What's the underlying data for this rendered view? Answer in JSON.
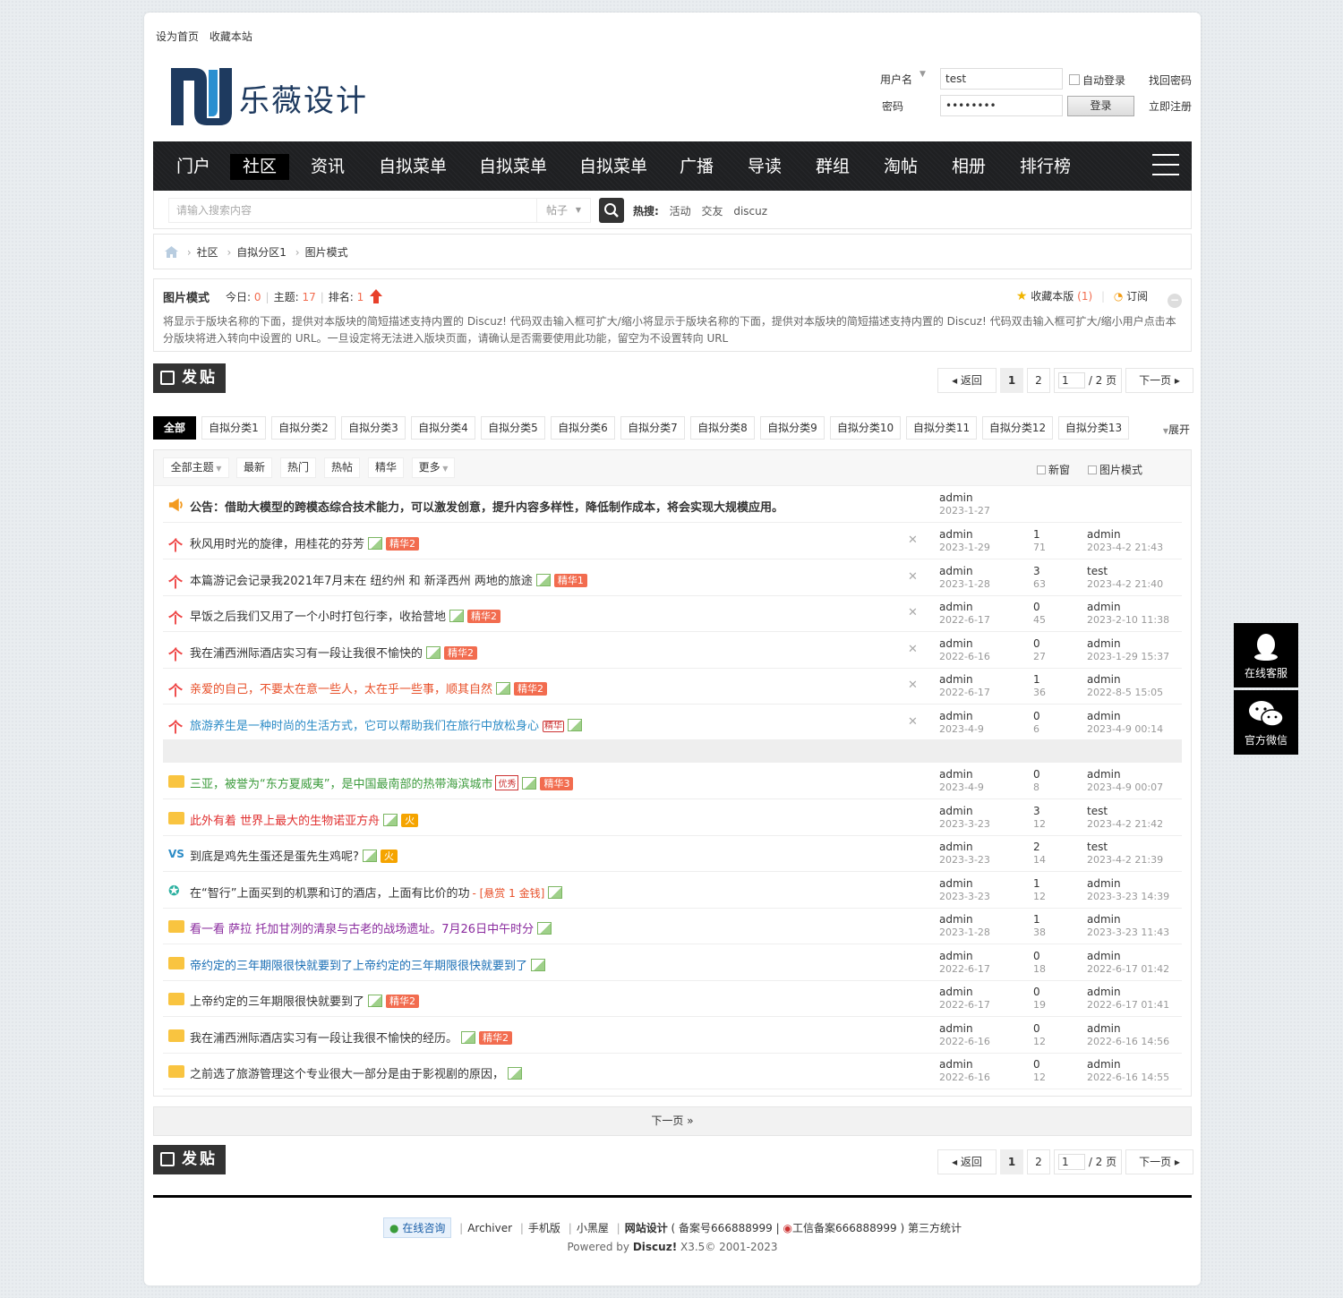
{
  "topnav": {
    "set_home": "设为首页",
    "bookmark": "收藏本站"
  },
  "logo": {
    "text": "乐薇设计"
  },
  "login": {
    "username_label": "用户名",
    "username_value": "test",
    "auto_login": "自动登录",
    "forgot": "找回密码",
    "password_label": "密码",
    "password_value": "••••••••",
    "login_btn": "登录",
    "register": "立即注册"
  },
  "mainnav": [
    "门户",
    "社区",
    "资讯",
    "自拟菜单",
    "自拟菜单",
    "自拟菜单",
    "广播",
    "导读",
    "群组",
    "淘帖",
    "相册",
    "排行榜"
  ],
  "search": {
    "placeholder": "请输入搜索内容",
    "type": "帖子",
    "hot_label": "热搜:",
    "hot": [
      "活动",
      "交友",
      "discuz"
    ]
  },
  "breadcrumb": [
    "社区",
    "自拟分区1",
    "图片模式"
  ],
  "forum": {
    "title": "图片模式",
    "today_label": "今日:",
    "today": "0",
    "topics_label": "主题:",
    "topics": "17",
    "rank_label": "排名:",
    "rank": "1",
    "favorite": "收藏本版",
    "favorite_count": "(1)",
    "subscribe": "订阅",
    "desc": "将显示于版块名称的下面，提供对本版块的简短描述支持内置的 Discuz! 代码双击输入框可扩大/缩小将显示于版块名称的下面，提供对本版块的简短描述支持内置的 Discuz! 代码双击输入框可扩大/缩小用户点击本分版块将进入转向中设置的 URL。一旦设定将无法进入版块页面，请确认是否需要使用此功能，留空为不设置转向 URL"
  },
  "post_btn": "发贴",
  "pager": {
    "back": "返回",
    "p1": "1",
    "p2": "2",
    "input": "1",
    "total": "/ 2 页",
    "next": "下一页"
  },
  "typetabs": [
    "全部",
    "自拟分类1",
    "自拟分类2",
    "自拟分类3",
    "自拟分类4",
    "自拟分类5",
    "自拟分类6",
    "自拟分类7",
    "自拟分类8",
    "自拟分类9",
    "自拟分类10",
    "自拟分类11",
    "自拟分类12",
    "自拟分类13"
  ],
  "expand": "展开",
  "filters": {
    "all": "全部主题",
    "latest": "最新",
    "hot": "热门",
    "hotpost": "热帖",
    "digest": "精华",
    "more": "更多",
    "newwin": "新窗",
    "imgmode": "图片模式"
  },
  "announce": {
    "text": "公告：借助大模型的跨模态综合技术能力，可以激发创意，提升内容多样性，降低制作成本，将会实现大规模应用。",
    "author": "admin",
    "date": "2023-1-27"
  },
  "sticky": [
    {
      "title": "秋风用时光的旋律，用桂花的芬芳",
      "tag": "精华2",
      "author": "admin",
      "date": "2023-1-29",
      "replies": "1",
      "views": "71",
      "last": "admin",
      "last_time": "2023-4-2 21:43",
      "color": "#333333"
    },
    {
      "title": "本篇游记会记录我2021年7月末在 纽约州 和 新泽西州 两地的旅途",
      "tag": "精华1",
      "author": "admin",
      "date": "2023-1-28",
      "replies": "3",
      "views": "63",
      "last": "test",
      "last_time": "2023-4-2 21:40",
      "color": "#333333"
    },
    {
      "title": "早饭之后我们又用了一个小时打包行李，收拾营地",
      "tag": "精华2",
      "author": "admin",
      "date": "2022-6-17",
      "replies": "0",
      "views": "45",
      "last": "admin",
      "last_time": "2023-2-10 11:38",
      "color": "#333333"
    },
    {
      "title": "我在浦西洲际酒店实习有一段让我很不愉快的",
      "tag": "精华2",
      "author": "admin",
      "date": "2022-6-16",
      "replies": "0",
      "views": "27",
      "last": "admin",
      "last_time": "2023-1-29 15:37",
      "color": "#333333"
    },
    {
      "title": "亲爱的自己，不要太在意一些人，太在乎一些事，顺其自然",
      "tag": "精华2",
      "author": "admin",
      "date": "2022-6-17",
      "replies": "1",
      "views": "36",
      "last": "admin",
      "last_time": "2022-8-5 15:05",
      "color": "#e8502a"
    },
    {
      "title": "旅游养生是一种时尚的生活方式，它可以帮助我们在旅行中放松身心",
      "tag": "精华",
      "author": "admin",
      "date": "2023-4-9",
      "replies": "0",
      "views": "6",
      "last": "admin",
      "last_time": "2023-4-9 00:14",
      "color": "#2b8bc6"
    }
  ],
  "normal": [
    {
      "title": "三亚，被誉为“东方夏威夷”，是中国最南部的热带海滨城市",
      "badge": "优秀",
      "tag": "精华3",
      "author": "admin",
      "date": "2023-4-9",
      "replies": "0",
      "views": "8",
      "last": "admin",
      "last_time": "2023-4-9 00:07",
      "color": "#3c9b3c",
      "icon": "folder"
    },
    {
      "title": "此外有着 世界上最大的生物诺亚方舟",
      "tag": "火",
      "author": "admin",
      "date": "2023-3-23",
      "replies": "3",
      "views": "12",
      "last": "test",
      "last_time": "2023-4-2 21:42",
      "color": "#e03030",
      "icon": "folder"
    },
    {
      "title": "到底是鸡先生蛋还是蛋先生鸡呢?",
      "tag": "火",
      "author": "admin",
      "date": "2023-3-23",
      "replies": "2",
      "views": "14",
      "last": "test",
      "last_time": "2023-4-2 21:39",
      "color": "#333333",
      "icon": "vs"
    },
    {
      "title": "在“智行”上面买到的机票和订的酒店，上面有比价的功",
      "reward": "- [悬赏 1 金钱]",
      "author": "admin",
      "date": "2023-3-23",
      "replies": "1",
      "views": "12",
      "last": "admin",
      "last_time": "2023-3-23 14:39",
      "color": "#333333",
      "icon": "award"
    },
    {
      "title": "看一看 萨拉 托加甘冽的清泉与古老的战场遗址。7月26日中午时分",
      "author": "admin",
      "date": "2023-1-28",
      "replies": "1",
      "views": "38",
      "last": "admin",
      "last_time": "2023-3-23 11:43",
      "color": "#8a2b9e",
      "icon": "folder"
    },
    {
      "title": "帝约定的三年期限很快就要到了上帝约定的三年期限很快就要到了",
      "author": "admin",
      "date": "2022-6-17",
      "replies": "0",
      "views": "18",
      "last": "admin",
      "last_time": "2022-6-17 01:42",
      "color": "#1b6fb5",
      "icon": "folder"
    },
    {
      "title": "上帝约定的三年期限很快就要到了",
      "tag": "精华2",
      "author": "admin",
      "date": "2022-6-17",
      "replies": "0",
      "views": "19",
      "last": "admin",
      "last_time": "2022-6-17 01:41",
      "color": "#333333",
      "icon": "folder"
    },
    {
      "title": "我在浦西洲际酒店实习有一段让我很不愉快的经历。",
      "tag": "精华2",
      "author": "admin",
      "date": "2022-6-16",
      "replies": "0",
      "views": "12",
      "last": "admin",
      "last_time": "2022-6-16 14:56",
      "color": "#333333",
      "icon": "folder"
    },
    {
      "title": "之前选了旅游管理这个专业很大一部分是由于影视剧的原因，",
      "author": "admin",
      "date": "2022-6-16",
      "replies": "0",
      "views": "12",
      "last": "admin",
      "last_time": "2022-6-16 14:55",
      "color": "#333333",
      "icon": "folder"
    }
  ],
  "next_page": "下一页 »",
  "footer": {
    "consult": "在线咨询",
    "archiver": "Archiver",
    "mobile": "手机版",
    "blackroom": "小黑屋",
    "site": "网站设计",
    "icp": "( 备案号666888999 |",
    "mps": "工信备案666888999 )",
    "stats": "第三方统计",
    "powered": "Powered by",
    "discuz": "Discuz!",
    "version": "X3.5© 2001-2023"
  },
  "side": {
    "service": "在线客服",
    "wechat": "官方微信"
  }
}
